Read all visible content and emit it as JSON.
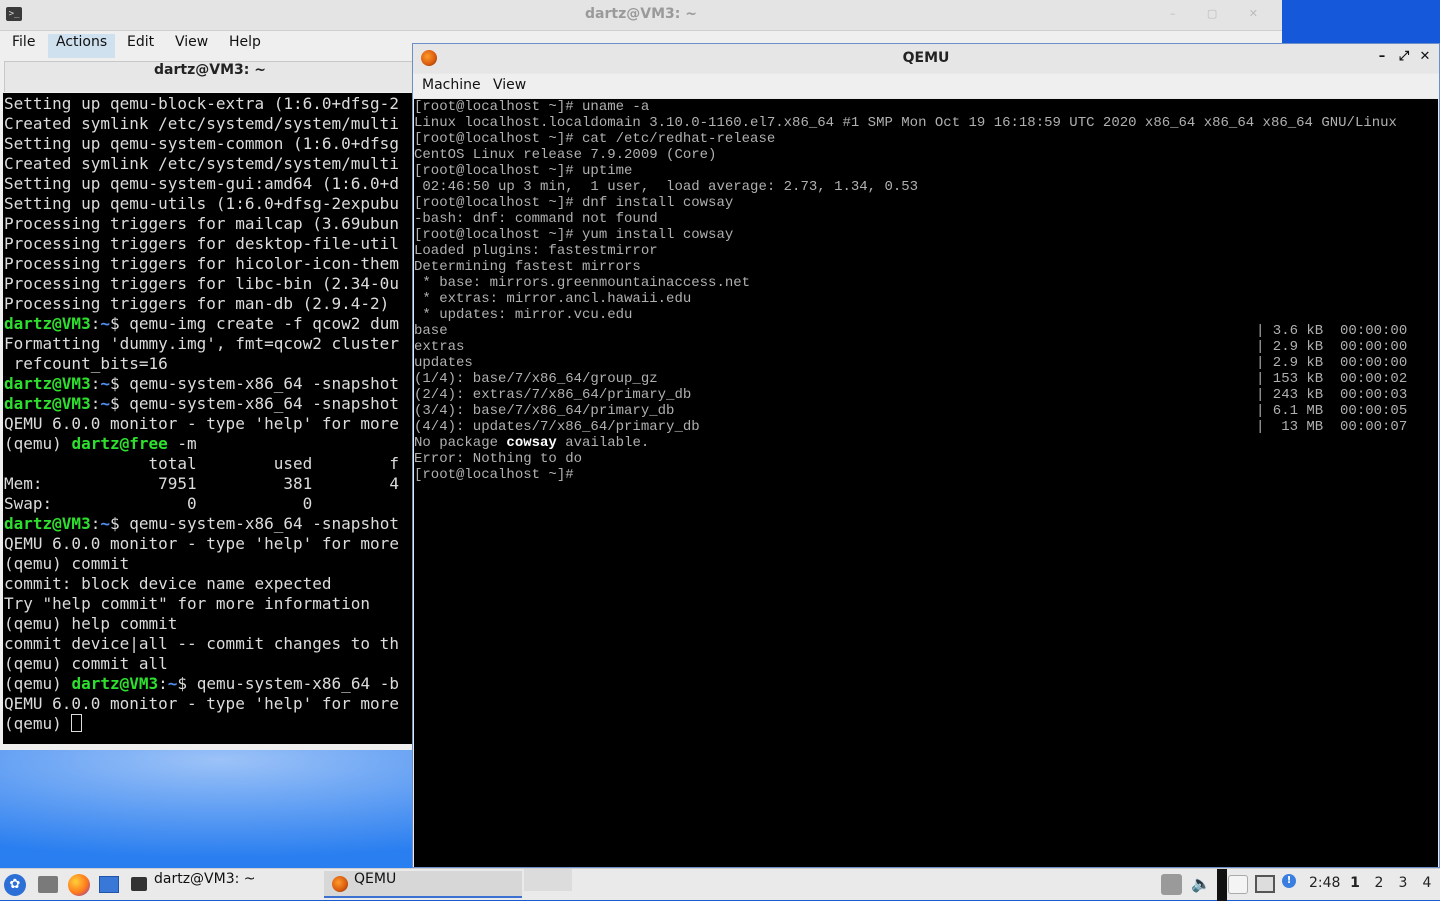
{
  "colors": {
    "desktop": "#1565e8",
    "prompt_user": "#2ee02e",
    "prompt_path": "#4f8ff0",
    "qemu_text": "#b0b0b0"
  },
  "terminal": {
    "window_title": "dartz@VM3: ~",
    "tab_title": "dartz@VM3: ~",
    "menu": [
      "File",
      "Actions",
      "Edit",
      "View",
      "Help"
    ],
    "active_menu": "Actions",
    "lines": [
      {
        "text": "Setting up qemu-block-extra (1:6.0+dfsg-2"
      },
      {
        "text": "Created symlink /etc/systemd/system/multi"
      },
      {
        "text": "Setting up qemu-system-common (1:6.0+dfsg"
      },
      {
        "text": "Created symlink /etc/systemd/system/multi"
      },
      {
        "text": "Setting up qemu-system-gui:amd64 (1:6.0+d"
      },
      {
        "text": "Setting up qemu-utils (1:6.0+dfsg-2expubu"
      },
      {
        "text": "Processing triggers for mailcap (3.69ubun"
      },
      {
        "text": "Processing triggers for desktop-file-util"
      },
      {
        "text": "Processing triggers for hicolor-icon-them"
      },
      {
        "text": "Processing triggers for libc-bin (2.34-0u"
      },
      {
        "text": "Processing triggers for man-db (2.9.4-2)"
      },
      {
        "pre": "",
        "user": "dartz@VM3",
        "sep": ":",
        "path": "~",
        "text": "$ qemu-img create -f qcow2 dum"
      },
      {
        "text": "Formatting 'dummy.img', fmt=qcow2 cluster"
      },
      {
        "text": " refcount_bits=16"
      },
      {
        "pre": "",
        "user": "dartz@VM3",
        "sep": ":",
        "path": "~",
        "text": "$ qemu-system-x86_64 -snapshot"
      },
      {
        "pre": "",
        "user": "dartz@VM3",
        "sep": ":",
        "path": "~",
        "text": "$ qemu-system-x86_64 -snapshot"
      },
      {
        "text": "QEMU 6.0.0 monitor - type 'help' for more"
      },
      {
        "pre": "(qemu) ",
        "user": "dartz@free",
        "text": " -m"
      },
      {
        "text": "               total        used        f"
      },
      {
        "text": "Mem:            7951         381        4"
      },
      {
        "text": "Swap:              0           0"
      },
      {
        "pre": "",
        "user": "dartz@VM3",
        "sep": ":",
        "path": "~",
        "text": "$ qemu-system-x86_64 -snapshot"
      },
      {
        "text": "QEMU 6.0.0 monitor - type 'help' for more"
      },
      {
        "text": "(qemu) commit"
      },
      {
        "text": "commit: block device name expected"
      },
      {
        "text": "Try \"help commit\" for more information"
      },
      {
        "text": "(qemu) help commit"
      },
      {
        "text": "commit device|all -- commit changes to th"
      },
      {
        "text": "(qemu) commit all"
      },
      {
        "pre": "(qemu) ",
        "user": "dartz@VM3",
        "sep": ":",
        "path": "~",
        "text": "$ qemu-system-x86_64 -b"
      },
      {
        "text": "QEMU 6.0.0 monitor - type 'help' for more"
      },
      {
        "text": "(qemu) ",
        "cursor": true
      }
    ]
  },
  "qemu": {
    "window_title": "QEMU",
    "menu": [
      "Machine",
      "View"
    ],
    "controls": {
      "minimize": "–",
      "restore": "⤢",
      "close": "✕"
    },
    "lines": [
      {
        "text": "[root@localhost ~]# uname -a"
      },
      {
        "text": "Linux localhost.localdomain 3.10.0-1160.el7.x86_64 #1 SMP Mon Oct 19 16:18:59 UTC 2020 x86_64 x86_64 x86_64 GNU/Linux"
      },
      {
        "text": "[root@localhost ~]# cat /etc/redhat-release"
      },
      {
        "text": "CentOS Linux release 7.9.2009 (Core)"
      },
      {
        "text": "[root@localhost ~]# uptime"
      },
      {
        "text": " 02:46:50 up 3 min,  1 user,  load average: 2.73, 1.34, 0.53"
      },
      {
        "text": "[root@localhost ~]# dnf install cowsay"
      },
      {
        "text": "-bash: dnf: command not found"
      },
      {
        "text": "[root@localhost ~]# yum install cowsay"
      },
      {
        "text": "Loaded plugins: fastestmirror"
      },
      {
        "text": "Determining fastest mirrors"
      },
      {
        "text": " * base: mirrors.greenmountainaccess.net"
      },
      {
        "text": " * extras: mirror.ancl.hawaii.edu"
      },
      {
        "text": " * updates: mirror.vcu.edu"
      },
      {
        "text": "base",
        "right": "| 3.6 kB  00:00:00"
      },
      {
        "text": "extras",
        "right": "| 2.9 kB  00:00:00"
      },
      {
        "text": "updates",
        "right": "| 2.9 kB  00:00:00"
      },
      {
        "text": "(1/4): base/7/x86_64/group_gz",
        "right": "| 153 kB  00:00:02"
      },
      {
        "text": "(2/4): extras/7/x86_64/primary_db",
        "right": "| 243 kB  00:00:03"
      },
      {
        "text": "(3/4): base/7/x86_64/primary_db",
        "right": "| 6.1 MB  00:00:05"
      },
      {
        "text": "(4/4): updates/7/x86_64/primary_db",
        "right": "|  13 MB  00:00:07"
      },
      {
        "text": "No package ",
        "hl": "cowsay",
        "tail": " available."
      },
      {
        "text": "Error: Nothing to do"
      },
      {
        "text": "[root@localhost ~]#"
      }
    ]
  },
  "taskbar": {
    "start_icon": "start-menu-icon",
    "launchers": [
      "file-manager-icon",
      "firefox-icon",
      "show-desktop-icon"
    ],
    "tasks": [
      {
        "label": "dartz@VM3: ~",
        "icon": "terminal-icon"
      },
      {
        "label": "QEMU",
        "icon": "qemu-icon",
        "active": true
      }
    ],
    "tray": [
      "tray-box-icon",
      "volume-icon",
      "clipboard-icon",
      "monitor-icon",
      "info-icon"
    ],
    "volume_glyph": "🔈",
    "info_glyph": "!",
    "clock": "2:48",
    "workspaces": [
      "1",
      "2",
      "3",
      "4"
    ],
    "active_workspace": "1"
  }
}
